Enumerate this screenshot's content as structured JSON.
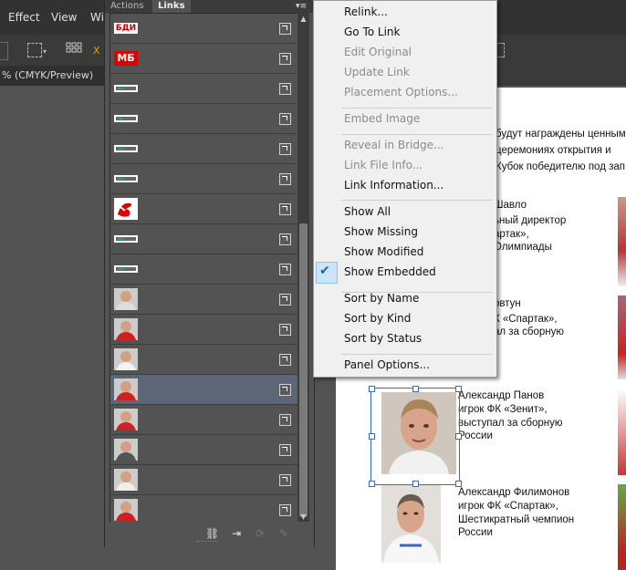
{
  "menubar": {
    "items": [
      "Effect",
      "View",
      "Wi"
    ]
  },
  "control_bar": {
    "partial_label": "X"
  },
  "document": {
    "tab_title": "% (CMYK/Preview)",
    "intro_lines": [
      "будут награждены ценным",
      "церемониях открытия и",
      "Кубок победителю под зап"
    ],
    "people": [
      {
        "lines": [
          "Шавло",
          "ьный директор",
          "артак»,",
          "Олимпиады"
        ]
      },
      {
        "lines": [
          "овтун",
          "К «Спартак»,",
          "ал за сборную"
        ]
      },
      {
        "lines": [
          "Александр Панов",
          "игрок ФК «Зенит»,",
          "выступал за сборную",
          "России"
        ]
      },
      {
        "lines": [
          "Александр Филимонов",
          "игрок ФК «Спартак»,",
          "Шестикратный чемпион",
          "России"
        ]
      }
    ]
  },
  "panel": {
    "tabs": [
      {
        "label": "Actions",
        "active": false
      },
      {
        "label": "Links",
        "active": true
      }
    ],
    "menu_icon": "panel-menu-icon",
    "rows": [
      {
        "thumb": "logo-bdi",
        "selected": false
      },
      {
        "thumb": "logo-mb",
        "selected": false
      },
      {
        "thumb": "logo-text",
        "selected": false
      },
      {
        "thumb": "logo-text",
        "selected": false
      },
      {
        "thumb": "logo-text",
        "selected": false
      },
      {
        "thumb": "logo-text",
        "selected": false
      },
      {
        "thumb": "logo-spartak",
        "selected": false
      },
      {
        "thumb": "logo-text",
        "selected": false
      },
      {
        "thumb": "logo-text",
        "selected": false
      },
      {
        "thumb": "photo",
        "selected": false
      },
      {
        "thumb": "photo",
        "selected": false
      },
      {
        "thumb": "photo",
        "selected": false
      },
      {
        "thumb": "photo",
        "selected": true
      },
      {
        "thumb": "photo",
        "selected": false
      },
      {
        "thumb": "photo",
        "selected": false
      },
      {
        "thumb": "photo",
        "selected": false
      },
      {
        "thumb": "photo",
        "selected": false
      }
    ],
    "logo_bdi_text": "БДИ",
    "logo_mb_text": "МБ",
    "footer_icons": [
      "relink-icon",
      "goto-link-icon",
      "update-link-icon",
      "edit-original-icon"
    ]
  },
  "context_menu": {
    "items": [
      {
        "label": "Relink...",
        "enabled": true
      },
      {
        "label": "Go To Link",
        "enabled": true
      },
      {
        "label": "Edit Original",
        "enabled": false
      },
      {
        "label": "Update Link",
        "enabled": false
      },
      {
        "label": "Placement Options...",
        "enabled": false
      },
      {
        "label": "Embed Image",
        "enabled": false
      },
      {
        "label": "Reveal in Bridge...",
        "enabled": false
      },
      {
        "label": "Link File Info...",
        "enabled": false
      },
      {
        "label": "Link Information...",
        "enabled": true
      },
      {
        "label": "Show All",
        "enabled": true
      },
      {
        "label": "Show Missing",
        "enabled": true
      },
      {
        "label": "Show Modified",
        "enabled": true
      },
      {
        "label": "Show Embedded",
        "enabled": true,
        "checked": true
      },
      {
        "label": "Sort by Name",
        "enabled": true
      },
      {
        "label": "Sort by Kind",
        "enabled": true
      },
      {
        "label": "Sort by Status",
        "enabled": true
      },
      {
        "label": "Panel Options...",
        "enabled": true
      }
    ]
  },
  "colors": {
    "selection": "#2e6ad6",
    "row_selected": "#5d6676",
    "accent_orange": "#e8a000"
  }
}
